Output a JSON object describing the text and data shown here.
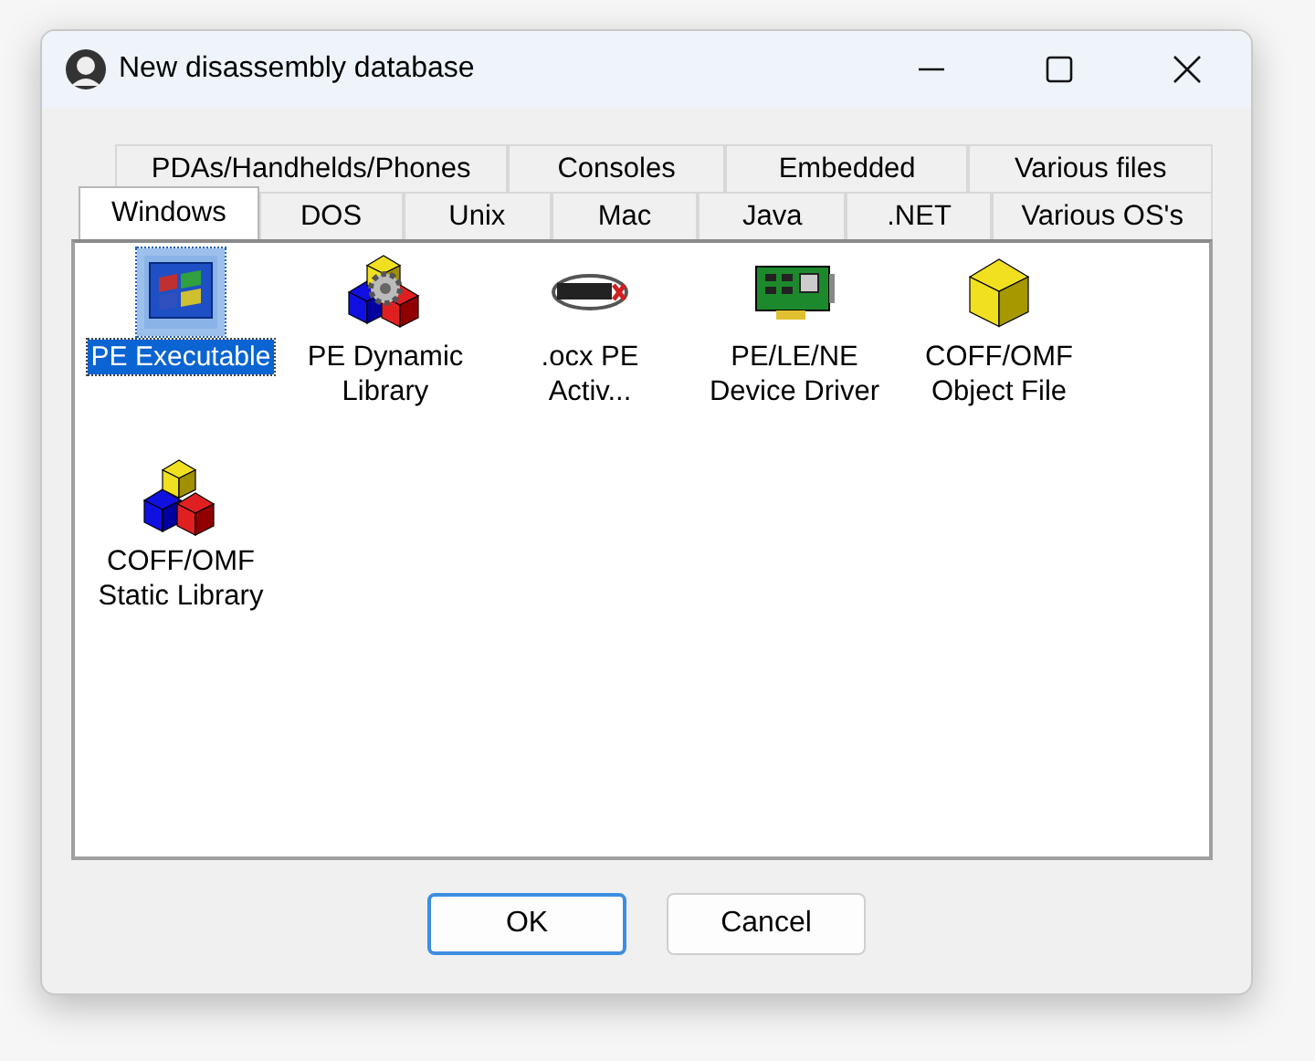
{
  "window": {
    "title": "New disassembly database"
  },
  "tab_rows": [
    [
      {
        "label": "PDAs/Handhelds/Phones",
        "selected": false
      },
      {
        "label": "Consoles",
        "selected": false
      },
      {
        "label": "Embedded",
        "selected": false
      },
      {
        "label": "Various files",
        "selected": false
      }
    ],
    [
      {
        "label": "Windows",
        "selected": true
      },
      {
        "label": "DOS",
        "selected": false
      },
      {
        "label": "Unix",
        "selected": false
      },
      {
        "label": "Mac",
        "selected": false
      },
      {
        "label": "Java",
        "selected": false
      },
      {
        "label": ".NET",
        "selected": false
      },
      {
        "label": "Various OS's",
        "selected": false
      }
    ]
  ],
  "items": [
    {
      "label": "PE Executable",
      "kind": "exe",
      "selected": true
    },
    {
      "label": "PE Dynamic Library",
      "kind": "dll",
      "selected": false
    },
    {
      "label": ".ocx PE Activ...",
      "kind": "activex",
      "selected": false
    },
    {
      "label": "PE/LE/NE Device Driver",
      "kind": "driver",
      "selected": false
    },
    {
      "label": "COFF/OMF Object File",
      "kind": "object",
      "selected": false
    },
    {
      "label": "COFF/OMF Static Library",
      "kind": "library",
      "selected": false
    }
  ],
  "buttons": [
    {
      "label": "OK",
      "default": true
    },
    {
      "label": "Cancel",
      "default": false
    }
  ]
}
